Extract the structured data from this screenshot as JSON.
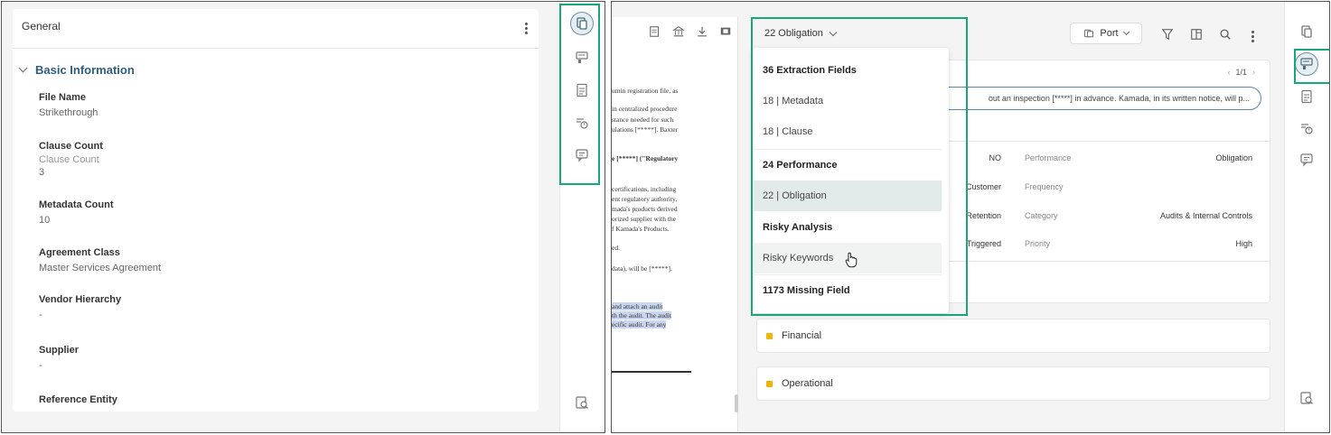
{
  "left": {
    "card_title": "General",
    "section_title": "Basic Information",
    "fields": [
      {
        "label": "File Name",
        "value": "Strikethrough"
      },
      {
        "label": "Clause Count",
        "placeholder": "Clause Count",
        "value": "3"
      },
      {
        "label": "Metadata Count",
        "value": "10"
      },
      {
        "label": "Agreement Class",
        "value": "Master Services Agreement"
      },
      {
        "label": "Vendor Hierarchy",
        "value": "-"
      },
      {
        "label": "Supplier",
        "value": "-"
      },
      {
        "label": "Reference Entity",
        "value": ""
      }
    ]
  },
  "right": {
    "doc_lines": [
      "umin registration file, as",
      "in centralized procedure",
      "stance needed for such",
      "ulations [*****]. Baxter",
      "e [*****] (\"Regulatory",
      "certifications, including",
      "ent regulatory authority,",
      "mada's products derived",
      "orized supplier with the",
      "f Kamada's Products.",
      "ed.",
      "data), will be [*****].",
      "and attach an audit",
      "th the audit. The audit",
      "ecific audit. For any"
    ],
    "obligation_select": "22 Obligation",
    "port_button": "Port",
    "pager": "1/1",
    "snippet": "out an inspection [*****] in advance. Kamada, in its written notice, will p...",
    "attributes": [
      {
        "left_value": "NO",
        "label": "Performance",
        "value": "Obligation"
      },
      {
        "left_value": "Customer",
        "label": "Frequency",
        "value": ""
      },
      {
        "left_value": "Retention",
        "label": "Category",
        "value": "Audits & Internal Controls"
      },
      {
        "left_value": "Triggered",
        "label": "Priority",
        "value": "High"
      }
    ],
    "accordions": [
      "Financial",
      "Operational"
    ],
    "dropdown": [
      {
        "label": "36 Extraction Fields",
        "kind": "head"
      },
      {
        "label": "18 | Metadata",
        "kind": "item"
      },
      {
        "label": "18 | Clause",
        "kind": "item"
      },
      {
        "label": "24 Performance",
        "kind": "head"
      },
      {
        "label": "22 | Obligation",
        "kind": "selected"
      },
      {
        "label": "Risky Analysis",
        "kind": "head"
      },
      {
        "label": "Risky Keywords",
        "kind": "hover"
      },
      {
        "label": "1173 Missing Field",
        "kind": "head"
      }
    ]
  },
  "colors": {
    "highlight": "#1aa67c",
    "accent": "#2e5d7c",
    "accordion_dot": "#f0b400"
  }
}
